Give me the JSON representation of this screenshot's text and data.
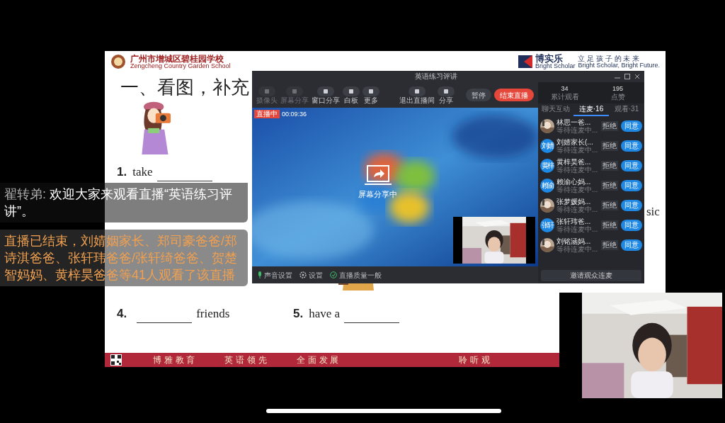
{
  "slide": {
    "school_name": "广州市增城区碧桂园学校",
    "school_name_en": "Zengcheng Country Garden School",
    "brand": "博实乐",
    "brand_en": "Bright Scholar",
    "motto": "立 足 孩 子 的 未 来",
    "slogan": "Bright Scholar, Bright Future.",
    "heading": "一、看图，补充",
    "exercises": [
      {
        "number": "1.",
        "text": "take",
        "kind": "blank_after"
      },
      {
        "number": "4.",
        "text": "friends",
        "kind": "blank_before"
      },
      {
        "number": "5.",
        "text": "have a",
        "kind": "blank_after"
      }
    ],
    "column_fragment": "sic",
    "footer_left": [
      "博 雅 教 育",
      "英 语 领 先",
      "全 面 发 展"
    ],
    "footer_right": "聆 听 观"
  },
  "stream_window": {
    "title": "英语练习评讲",
    "toolbar": [
      {
        "label": "摄像头",
        "disabled": true
      },
      {
        "label": "屏幕分享",
        "disabled": true
      },
      {
        "label": "窗口分享",
        "disabled": false
      },
      {
        "label": "白板",
        "disabled": false
      },
      {
        "label": "更多",
        "disabled": false
      },
      {
        "label": "退出直播间",
        "disabled": false
      },
      {
        "label": "分享",
        "disabled": false
      }
    ],
    "pause_button": "暂停",
    "end_button": "结束直播",
    "live_badge": "直播中",
    "timer": "00:09:36",
    "share_status": "屏幕分享中",
    "stats": [
      {
        "value": "34",
        "label": "累计观看"
      },
      {
        "value": "195",
        "label": "点赞"
      }
    ],
    "tabs": [
      {
        "label": "聊天互动",
        "selected": false
      },
      {
        "label": "连麦·16",
        "selected": true
      },
      {
        "label": "观看·31",
        "selected": false
      }
    ],
    "requests": [
      {
        "name": "林思一爸...",
        "status": "等待连麦中..."
      },
      {
        "name": "刘婧家长(...",
        "status": "等待连麦中...",
        "avatar": {
          "kind": "initials",
          "text": "刘婧"
        }
      },
      {
        "name": "黄梓昊爸...",
        "status": "等待连麦中...",
        "avatar": {
          "kind": "initials",
          "text": "黄梓"
        }
      },
      {
        "name": "赖渝心妈...",
        "status": "等待连麦中...",
        "avatar": {
          "kind": "initials",
          "text": "赖渝"
        }
      },
      {
        "name": "张梦媛妈...",
        "status": "等待连麦中..."
      },
      {
        "name": "张轩玮爸...",
        "status": "等待连麦中...",
        "avatar": {
          "kind": "initials",
          "text": "张轩"
        }
      },
      {
        "name": "刘铭涵妈...",
        "status": "等待连麦中..."
      }
    ],
    "reject_labels": [
      "拒绝",
      "拒绝",
      "拒绝",
      "拒绝",
      "拒绝",
      "拒绝",
      "拒绝"
    ],
    "accept_labels": [
      "同意",
      "同意",
      "同意",
      "同意",
      "同意",
      "同意",
      "同意"
    ],
    "invite_button": "邀请观众连麦",
    "bottom_bar": [
      {
        "kind": "mic",
        "label": "声音设置"
      },
      {
        "kind": "settings",
        "label": "设置"
      },
      {
        "kind": "quality",
        "label": "直播质量一般"
      }
    ]
  },
  "comment": {
    "author": "翟转弟:",
    "text": "欢迎大家来观看直播“英语练习评讲”。"
  },
  "notice": "直播已结束，刘婧姻家长、郑司豪爸爸/郑诗淇爸爸、张轩玮爸爸/张轩绮爸爸、贺楚智妈妈、黄梓昊爸爸等41人观看了该直播"
}
